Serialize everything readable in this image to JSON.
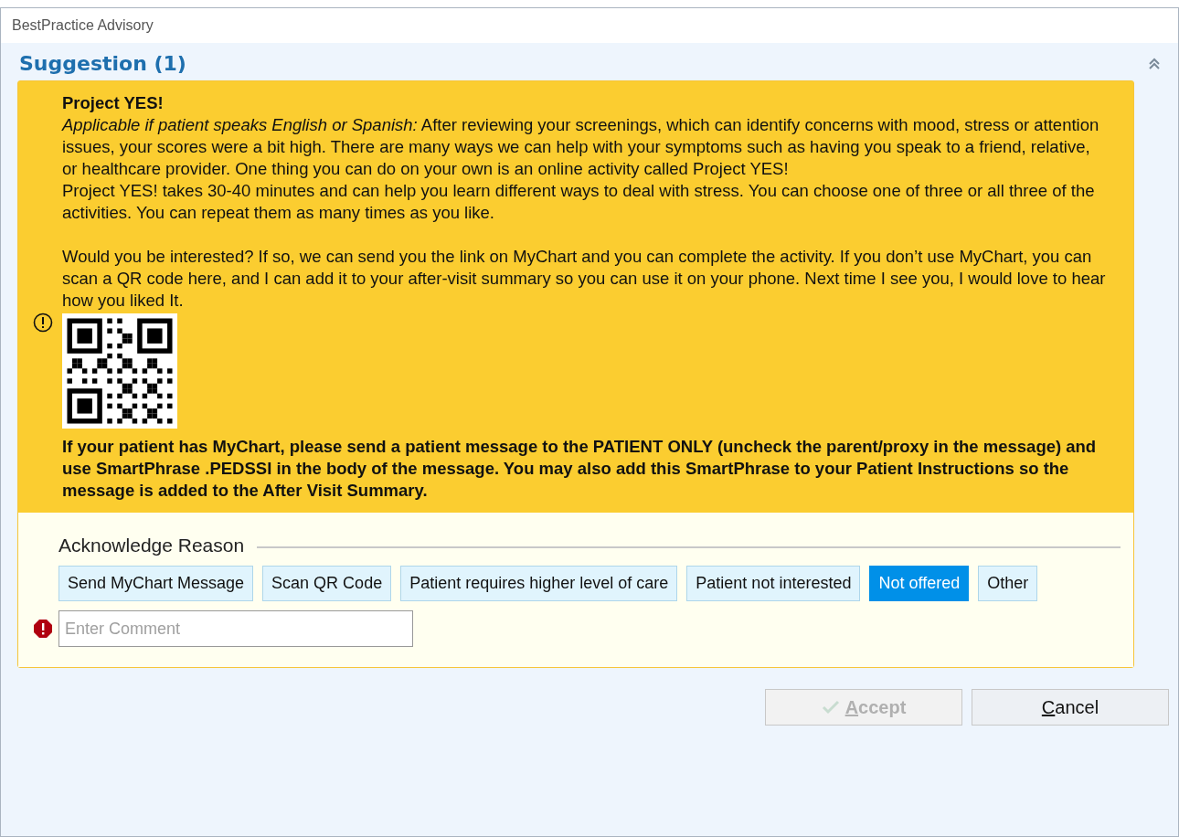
{
  "window": {
    "title": "BestPractice Advisory"
  },
  "section": {
    "title": "Suggestion (1)",
    "expanded": true
  },
  "advisory": {
    "title": "Project YES!",
    "paragraphs": [
      "*Applicable if patient speaks English or Spanish:* After reviewing your screenings, which can identify concerns with mood, stress or attention issues, your scores were a bit high. There are many ways we can help with your symptoms such as having you speak to a friend, relative, or healthcare provider. One thing you can do on your own is an online activity called Project YES!",
      "Project YES! takes 30-40 minutes and can help you learn different ways to deal with stress. You can choose one of three or all three of the activities. You can repeat them as many times as you like.",
      "Would you be interested? If so, we can send you the link on MyChart and you can complete the activity. If you don’t use MyChart, you can scan a QR code here, and I can add it to your after-visit summary so you can use it on your phone.  Next time I see you, I would love to hear how you liked It."
    ],
    "instructions": "If your patient has MyChart, please send a patient message to the PATIENT ONLY (uncheck the parent/proxy in the message) and use SmartPhrase .PEDSSI in the body of the message. You may also add this SmartPhrase to your Patient Instructions so the message is added to the After Visit Summary."
  },
  "acknowledge": {
    "label": "Acknowledge Reason",
    "reasons": [
      {
        "label": "Send MyChart Message",
        "selected": false
      },
      {
        "label": "Scan QR Code",
        "selected": false
      },
      {
        "label": "Patient requires higher level of care",
        "selected": false
      },
      {
        "label": "Patient not interested",
        "selected": false
      },
      {
        "label": "Not offered",
        "selected": true
      },
      {
        "label": "Other",
        "selected": false
      }
    ],
    "comment": {
      "placeholder": "Enter Comment",
      "required": true
    }
  },
  "buttons": [
    {
      "kind": "accept",
      "label": "Accept",
      "disabled": true
    },
    {
      "kind": "cancel",
      "label": "Cancel",
      "disabled": false
    }
  ]
}
